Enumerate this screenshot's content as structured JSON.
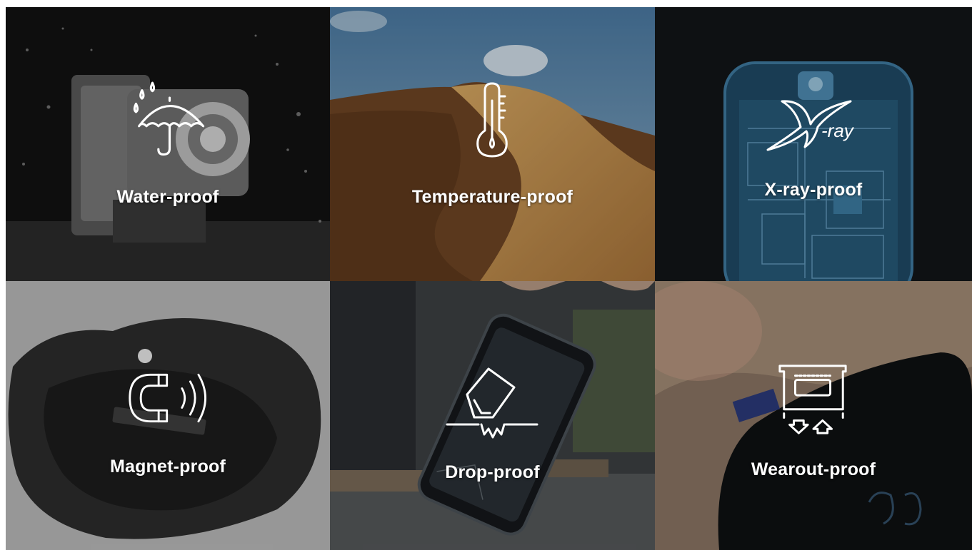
{
  "tiles": {
    "water": {
      "label": "Water-proof",
      "icon": "umbrella-rain-icon"
    },
    "temperature": {
      "label": "Temperature-proof",
      "icon": "thermometer-icon"
    },
    "xray": {
      "label": "X-ray-proof",
      "icon": "x-ray-icon",
      "logo_text": "-ray"
    },
    "magnet": {
      "label": "Magnet-proof",
      "icon": "magnet-icon"
    },
    "drop": {
      "label": "Drop-proof",
      "icon": "drop-card-icon"
    },
    "wearout": {
      "label": "Wearout-proof",
      "icon": "card-tray-icon"
    }
  },
  "colors": {
    "icon_stroke": "#ffffff",
    "desert_sky": "#5f86a8",
    "sand": "#c79450",
    "xray_blue": "#2d6a8f"
  }
}
